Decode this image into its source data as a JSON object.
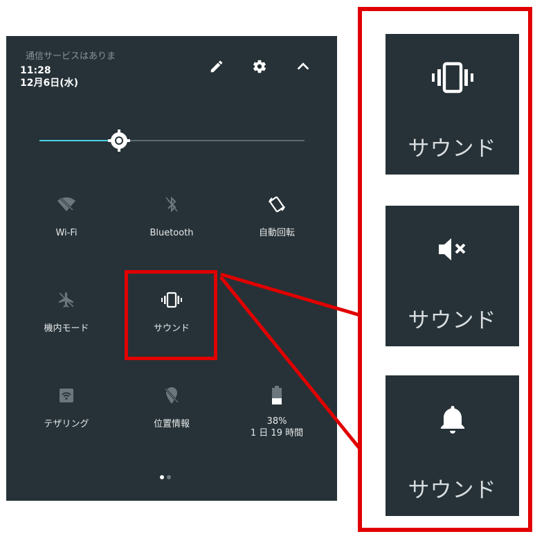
{
  "status": {
    "carrier": "通信サービスはありま",
    "time": "11:28",
    "date": "12月6日(水)"
  },
  "header_icons": [
    "edit-icon",
    "settings-icon",
    "collapse-icon"
  ],
  "brightness": {
    "level": 0.3
  },
  "tiles": [
    {
      "icon": "wifi-off-icon",
      "label": "Wi-Fi"
    },
    {
      "icon": "bluetooth-off-icon",
      "label": "Bluetooth"
    },
    {
      "icon": "auto-rotate-icon",
      "label": "自動回転"
    },
    {
      "icon": "airplane-icon",
      "label": "機内モード"
    },
    {
      "icon": "vibrate-icon",
      "label": "サウンド"
    },
    {
      "icon": "hotspot-icon",
      "label": "テザリング"
    },
    {
      "icon": "location-off-icon",
      "label": "位置情報"
    },
    {
      "icon": "battery-icon",
      "label": "38%",
      "sublabel": "1 日 19 時間"
    }
  ],
  "pages": {
    "count": 2,
    "current": 1
  },
  "sound_cards": [
    {
      "icon": "vibrate-icon",
      "label": "サウンド"
    },
    {
      "icon": "mute-icon",
      "label": "サウンド"
    },
    {
      "icon": "bell-icon",
      "label": "サウンド"
    }
  ],
  "colors": {
    "panel": "#263238",
    "accent": "#4dd0e1",
    "highlight": "#e00000"
  }
}
